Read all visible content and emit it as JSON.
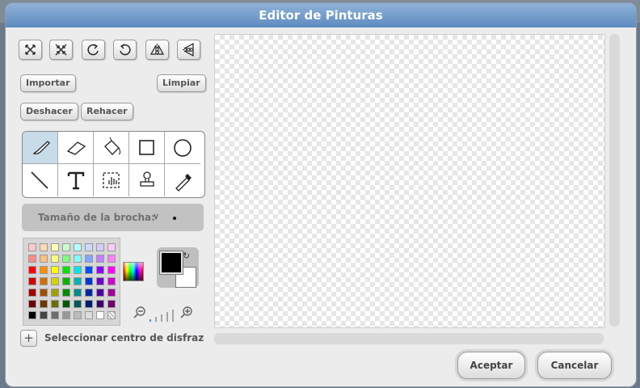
{
  "window": {
    "title": "Editor de Pinturas"
  },
  "toolbar": {
    "top_icons": [
      "grow-icon",
      "shrink-icon",
      "rotate-ccw-icon",
      "rotate-cw-icon",
      "flip-horizontal-icon",
      "flip-vertical-icon"
    ],
    "import_label": "Importar",
    "clear_label": "Limpiar",
    "undo_label": "Deshacer",
    "redo_label": "Rehacer"
  },
  "tools": {
    "items": [
      "paintbrush-icon",
      "eraser-icon",
      "fill-bucket-icon",
      "rectangle-icon",
      "ellipse-icon",
      "line-icon",
      "text-icon",
      "select-icon",
      "stamp-icon",
      "eyedropper-icon"
    ],
    "active": "paintbrush-icon"
  },
  "brush": {
    "label": "Tamaño de la brocha:",
    "chevron": "∨"
  },
  "palette": {
    "rows": [
      [
        "#ffc9c9",
        "#ffd9b3",
        "#ffffb3",
        "#c9ffc9",
        "#b3ffff",
        "#c9d9ff",
        "#d9c9ff",
        "#ffc9ff"
      ],
      [
        "#ff8a8a",
        "#ffbf80",
        "#ffff80",
        "#80ff80",
        "#80ffff",
        "#80a6ff",
        "#c080ff",
        "#ff80ff"
      ],
      [
        "#ff0000",
        "#ff8c00",
        "#ffff00",
        "#00e600",
        "#00e6e6",
        "#0050ff",
        "#8c00ff",
        "#ff00ff"
      ],
      [
        "#d20000",
        "#d26e00",
        "#d2d200",
        "#00b400",
        "#00b4b4",
        "#0037d2",
        "#6e00d2",
        "#d200d2"
      ],
      [
        "#a00000",
        "#a05000",
        "#a0a000",
        "#008c00",
        "#008c8c",
        "#0028a0",
        "#5000a0",
        "#a000a0"
      ],
      [
        "#6e0000",
        "#6e3700",
        "#6e6e00",
        "#005a00",
        "#005a5a",
        "#001c6e",
        "#37006e",
        "#6e006e"
      ],
      [
        "#000000",
        "#444444",
        "#6e6e6e",
        "#999999",
        "#bbbbbb",
        "#dddddd",
        "#ffffff",
        "transparent"
      ]
    ],
    "foreground": "#000000",
    "background": "#ffffff"
  },
  "center": {
    "label": "Seleccionar centro de disfraz"
  },
  "footer": {
    "ok_label": "Aceptar",
    "cancel_label": "Cancelar"
  }
}
